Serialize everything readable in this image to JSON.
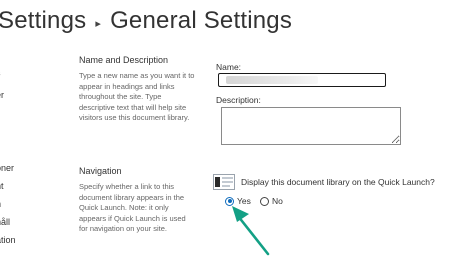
{
  "breadcrumb": {
    "parent": "Settings",
    "separator": "▸",
    "current": "General Settings"
  },
  "left_nav": {
    "items": [
      "s",
      "er",
      "oner",
      "nt",
      "n",
      "håll",
      "ation"
    ]
  },
  "name_description_section": {
    "title": "Name and Description",
    "description": "Type a new name as you want it to appear in headings and links throughout the site. Type descriptive text that will help site visitors use this document library.",
    "name_label": "Name:",
    "name_value": "",
    "description_label": "Description:",
    "description_value": ""
  },
  "navigation_section": {
    "title": "Navigation",
    "description": "Specify whether a link to this document library appears in the Quick Launch. Note: it only appears if Quick Launch is used for navigation on your site.",
    "quick_launch_icon": "quick-launch-icon",
    "quick_launch_question": "Display this document library on the Quick Launch?",
    "options": {
      "yes_label": "Yes",
      "no_label": "No",
      "selected": "Yes"
    }
  },
  "annotation": {
    "arrow_icon": "pointer-arrow-icon",
    "arrow_color": "#13a085"
  },
  "colors": {
    "accent": "#0f6cbd",
    "text": "#333333",
    "muted_text": "#666666"
  }
}
